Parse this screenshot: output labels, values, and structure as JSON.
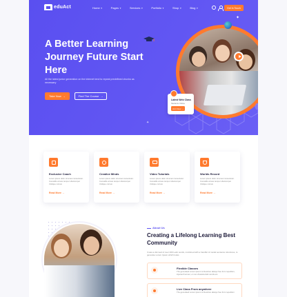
{
  "brand": {
    "logo_text": "eduAct",
    "accent": "#ff7a2e",
    "primary": "#5a4ff0"
  },
  "nav": {
    "items": [
      "Home",
      "Pages",
      "Services",
      "Portfolio",
      "Shop",
      "Blog"
    ],
    "cta_label": "Get In Touch"
  },
  "hero": {
    "title": "A Better Learning Journey Future Start Here",
    "description": "All the latest junior generation on the internet tend to repeat predefined chunks as necessary",
    "primary_button": "Take Now",
    "secondary_button": "Find The Course",
    "card": {
      "title": "Latest Web Class",
      "subtitle": "Students Online",
      "button": "Join Now"
    }
  },
  "features": [
    {
      "title": "Exclusive Coach",
      "description": "Lorem ipsum dolor sit amet consectetur. Convallis ornare tempor ullamcorper tristique cursus",
      "link": "Read More",
      "icon": "coach-icon"
    },
    {
      "title": "Creative Minds",
      "description": "Lorem ipsum dolor sit amet consectetur. Convallis ornare tempor ullamcorper tristique cursus",
      "link": "Read More",
      "icon": "mind-icon"
    },
    {
      "title": "Video Tutorials",
      "description": "Lorem ipsum dolor sit amet consectetur. Convallis ornare tempor ullamcorper tristique cursus",
      "link": "Read More",
      "icon": "video-icon"
    },
    {
      "title": "Worlds Record",
      "description": "Lorem ipsum dolor sit amet consectetur. Convallis ornare tempor ullamcorper tristique cursus",
      "link": "Read More",
      "icon": "trophy-icon"
    }
  ],
  "about": {
    "tag": "About Us",
    "title": "Creating a Lifelong Learning Best Community",
    "description": "It was a dimmed of over 200 Latin words, combined with a handful of model sentence structures, to generate Lorem Ipsum which looks",
    "items": [
      {
        "title": "Flexible Classes",
        "description": "The generated Lorem Ipsum is therefore always free from repetition, injected humour, or non-characteristic words etc."
      },
      {
        "title": "Live Class From anywhere",
        "description": "The generated Lorem Ipsum is therefore always free from repetition"
      }
    ]
  }
}
